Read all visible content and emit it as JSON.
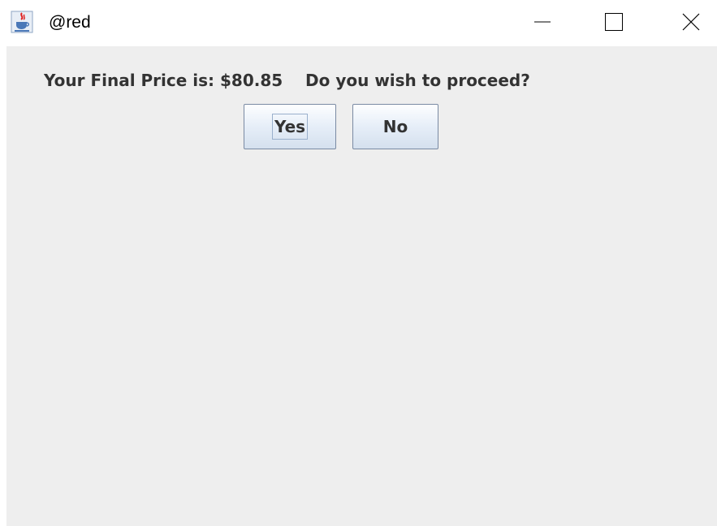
{
  "window": {
    "title": "@red",
    "controls": [
      "minimize",
      "maximize",
      "close"
    ]
  },
  "dialog": {
    "message": "Your Final Price is: $80.85    Do you wish to proceed?",
    "buttons": {
      "yes_label": "Yes",
      "no_label": "No"
    }
  },
  "icons": {
    "app": "java-coffee-cup-icon",
    "minimize": "minimize-icon",
    "maximize": "maximize-icon",
    "close": "close-icon"
  },
  "colors": {
    "content_bg": "#eeeeee",
    "text": "#333333",
    "button_border": "#7a8aa3"
  }
}
